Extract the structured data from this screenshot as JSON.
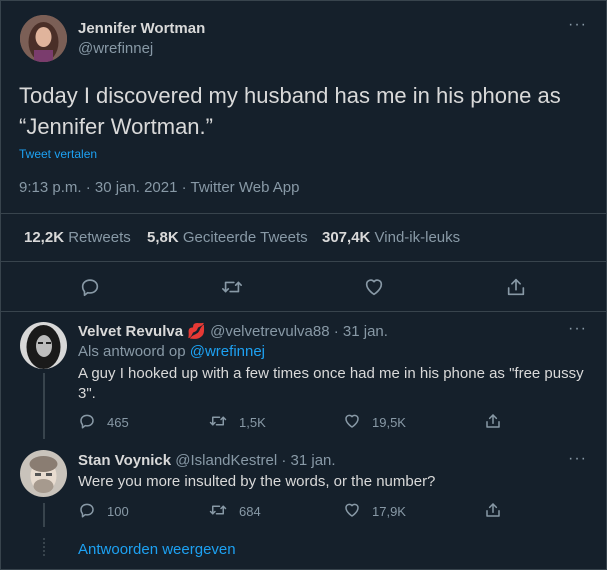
{
  "author": {
    "name": "Jennifer Wortman",
    "handle": "@wrefinnej"
  },
  "tweet": {
    "text_line1": "Today I discovered my husband has me in his phone as",
    "text_line2": "“Jennifer Wortman.”",
    "translate": "Tweet vertalen",
    "meta": "9:13 p.m. · 30 jan. 2021 · Twitter Web App"
  },
  "stats": {
    "retweets_count": "12,2K",
    "retweets_label": "Retweets",
    "quotes_count": "5,8K",
    "quotes_label": "Geciteerde Tweets",
    "likes_count": "307,4K",
    "likes_label": "Vind-ik-leuks"
  },
  "replies": [
    {
      "name": "Velvet Revulva",
      "emoji": "💋",
      "handle_time": "@velvetrevulva88 · 31 jan.",
      "reply_prefix": "Als antwoord op",
      "reply_to": "@wrefinnej",
      "text_line1": "A guy I hooked up with a few times once had me in his phone as \"free pussy",
      "text_line2": "3\".",
      "replies_count": "465",
      "retweets_count": "1,5K",
      "likes_count": "19,5K"
    },
    {
      "name": "Stan Voynick",
      "handle_time": "@IslandKestrel · 31 jan.",
      "text_line1": "Were you more insulted by the words, or the number?",
      "replies_count": "100",
      "retweets_count": "684",
      "likes_count": "17,9K"
    }
  ],
  "show_replies": "Antwoorden weergeven",
  "colors": {
    "background": "#15202b",
    "border": "#38444d",
    "text": "#d9d9d9",
    "muted": "#8899a6",
    "accent": "#1da1f2"
  }
}
